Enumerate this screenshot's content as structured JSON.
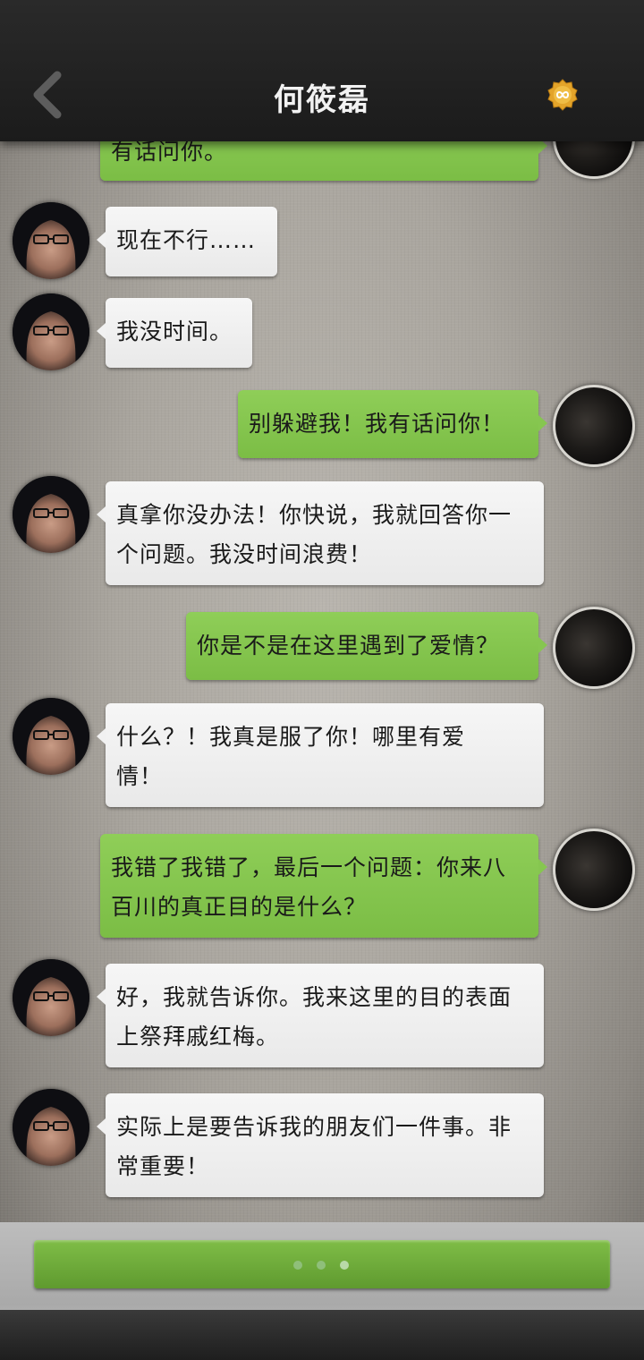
{
  "header": {
    "title": "何筱磊",
    "back_icon": "chevron-left-icon",
    "coin_icon": "infinity-coin-icon",
    "coin_color": "#e3a42a"
  },
  "messages": [
    {
      "side": "right",
      "text": "有话问你。"
    },
    {
      "side": "left",
      "text": "现在不行……"
    },
    {
      "side": "left",
      "text": "我没时间。"
    },
    {
      "side": "right",
      "text": "别躲避我！我有话问你！"
    },
    {
      "side": "left",
      "text": "真拿你没办法！你快说，我就回答你一个问题。我没时间浪费！"
    },
    {
      "side": "right",
      "text": "你是不是在这里遇到了爱情？"
    },
    {
      "side": "left",
      "text": "什么？！我真是服了你！哪里有爱情！"
    },
    {
      "side": "right",
      "text": "我错了我错了，最后一个问题：你来八百川的真正目的是什么？"
    },
    {
      "side": "left",
      "text": "好，我就告诉你。我来这里的目的表面上祭拜戚红梅。"
    },
    {
      "side": "left",
      "text": "实际上是要告诉我的朋友们一件事。非常重要！"
    }
  ],
  "colors": {
    "left_bubble": "#f1f1f1",
    "right_bubble": "#86c650",
    "continue_button": "#6fae3c"
  },
  "bottom": {
    "continue_icon": "typing-dots-icon"
  }
}
